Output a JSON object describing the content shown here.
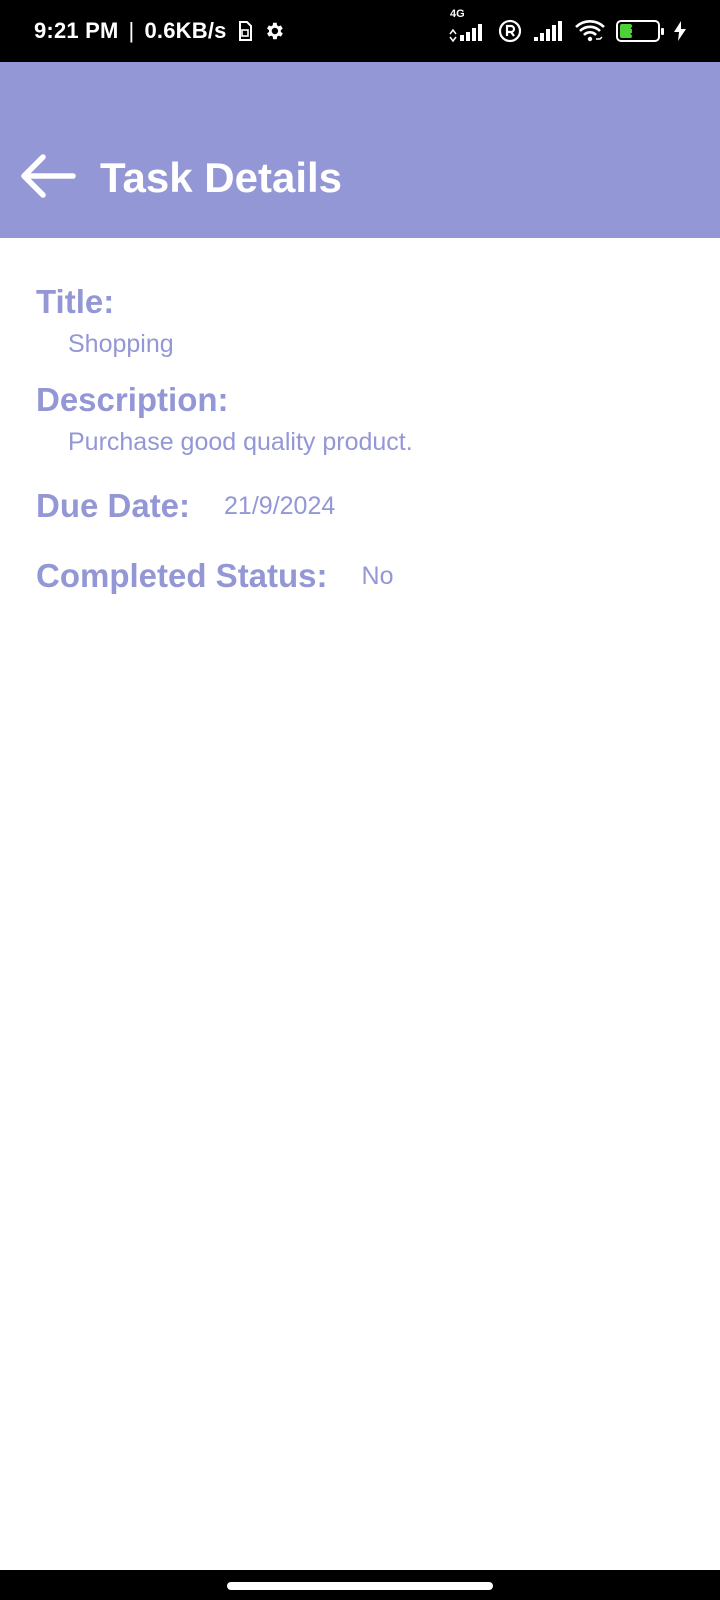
{
  "status_bar": {
    "time": "9:21 PM",
    "separator": "|",
    "speed": "0.6KB/s",
    "network_label": "4G",
    "battery_level": "33",
    "icons": [
      "sim-card-icon",
      "gear-icon",
      "signal-4g-icon",
      "roaming-r-icon",
      "signal-icon",
      "wifi-icon",
      "battery-icon",
      "charging-bolt-icon"
    ]
  },
  "app_bar": {
    "title": "Task Details",
    "back_icon": "arrow-left-icon",
    "background": "#9497d5"
  },
  "task": {
    "title_label": "Title:",
    "title_value": "Shopping",
    "description_label": "Description:",
    "description_value": "Purchase good quality product.",
    "due_date_label": "Due Date:",
    "due_date_value": "21/9/2024",
    "completed_label": "Completed Status:",
    "completed_value": "No"
  },
  "colors": {
    "accent": "#9497d5",
    "status_bar": "#000000",
    "battery": "#4cd137"
  }
}
